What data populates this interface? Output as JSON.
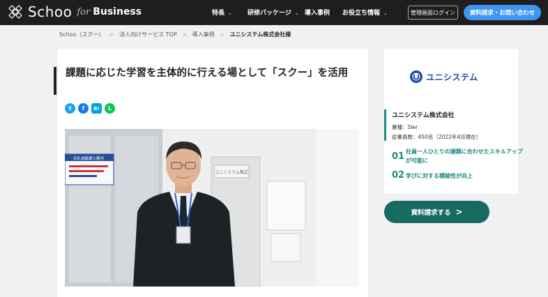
{
  "header": {
    "logo_word": "Schoo",
    "logo_for": "for",
    "logo_business": "Business",
    "nav": [
      {
        "label": "特長",
        "has_dropdown": true
      },
      {
        "label": "研修パッケージ",
        "has_dropdown": true
      },
      {
        "label": "導入事例",
        "has_dropdown": false
      },
      {
        "label": "お役立ち情報",
        "has_dropdown": true
      }
    ],
    "admin_login": "管理画面ログイン",
    "contact": "資料請求・お問い合わせ"
  },
  "breadcrumb": [
    "Schoo（スクー）",
    "法人向けサービス TOP",
    "導入事例",
    "ユニシステム株式会社様"
  ],
  "article": {
    "title": "課題に応じた学習を主体的に行える場として「スクー」を活用",
    "shares": [
      {
        "name": "twitter",
        "glyph": "t",
        "color": "#1da1f2"
      },
      {
        "name": "facebook",
        "glyph": "f",
        "color": "#1877f2"
      },
      {
        "name": "hatena",
        "glyph": "B!",
        "color": "#00a4de"
      },
      {
        "name": "line",
        "glyph": "L",
        "color": "#06c755"
      }
    ],
    "photo_sign": "名札自動導入案内",
    "photo_door_label": "ユニシステム株式"
  },
  "sidebar": {
    "logo_text": "ユニシステム",
    "company_name": "ユニシステム株式会社",
    "industry": "業種：SIer",
    "employees": "従業員数：450名（2022年4月現在）",
    "points": [
      {
        "num": "01",
        "text": "社員一人ひとりの課題に合わせたスキルアップが可能に"
      },
      {
        "num": "02",
        "text": "学びに対する積極性が向上"
      }
    ],
    "cta": "資料請求する",
    "cta_arrow": ">"
  },
  "colors": {
    "header_bg": "#1e1e1e",
    "accent_blue": "#3d96f2",
    "teal": "#1c8a7e",
    "cta_bg": "#176a60"
  }
}
